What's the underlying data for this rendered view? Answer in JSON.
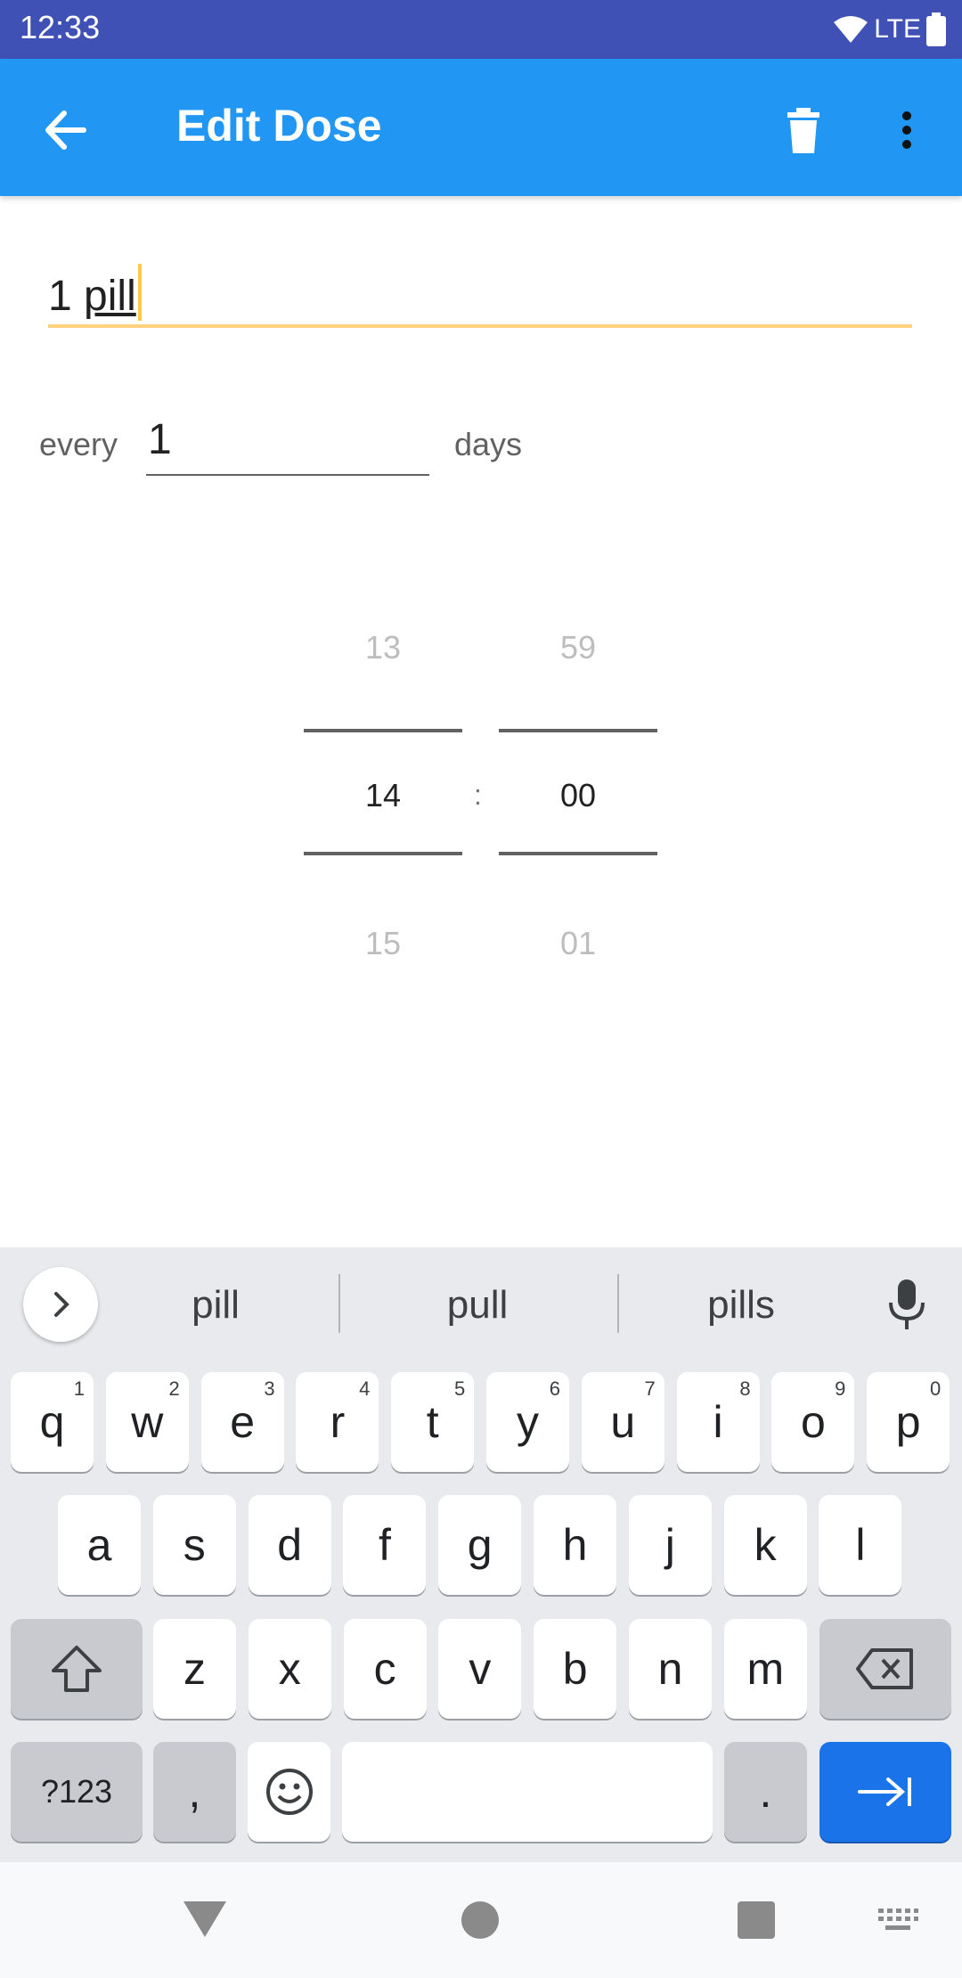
{
  "status_bar": {
    "time": "12:33",
    "network": "LTE"
  },
  "app_bar": {
    "title": "Edit Dose"
  },
  "dose": {
    "amount": "1",
    "unit": "pill"
  },
  "interval": {
    "prefix": "every",
    "value": "1",
    "suffix": "days"
  },
  "time_picker": {
    "hour": {
      "prev": "13",
      "current": "14",
      "next": "15"
    },
    "separator": ":",
    "minute": {
      "prev": "59",
      "current": "00",
      "next": "01"
    }
  },
  "keyboard": {
    "suggestions": [
      "pill",
      "pull",
      "pills"
    ],
    "row1": [
      {
        "k": "q",
        "h": "1"
      },
      {
        "k": "w",
        "h": "2"
      },
      {
        "k": "e",
        "h": "3"
      },
      {
        "k": "r",
        "h": "4"
      },
      {
        "k": "t",
        "h": "5"
      },
      {
        "k": "y",
        "h": "6"
      },
      {
        "k": "u",
        "h": "7"
      },
      {
        "k": "i",
        "h": "8"
      },
      {
        "k": "o",
        "h": "9"
      },
      {
        "k": "p",
        "h": "0"
      }
    ],
    "row2": [
      "a",
      "s",
      "d",
      "f",
      "g",
      "h",
      "j",
      "k",
      "l"
    ],
    "row3": [
      "z",
      "x",
      "c",
      "v",
      "b",
      "n",
      "m"
    ],
    "row4": {
      "symbols": "?123",
      "comma": ",",
      "period": "."
    },
    "accent_color": "#1A73E8"
  },
  "colors": {
    "status_bar": "#3F51B5",
    "app_bar": "#2196F3",
    "focus_underline": "#FFD27F"
  }
}
